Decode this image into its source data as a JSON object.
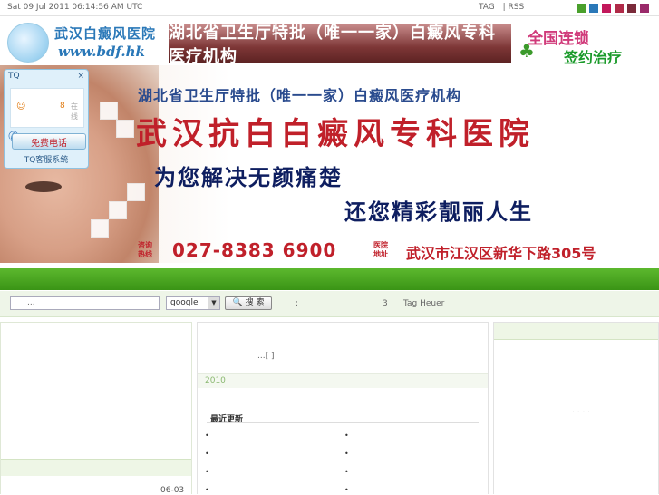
{
  "topbar": {
    "date": "Sat 09 Jul 2011 06:14:56 AM UTC",
    "links": [
      "TAG",
      "| RSS"
    ],
    "swatches": [
      "#4aa02c",
      "#2a78b8",
      "#c2185b",
      "#b02a48",
      "#7a2a3a",
      "#9a2a6a"
    ]
  },
  "header": {
    "logo_cn": "武汉白癜风医院",
    "logo_en": "www.bdf.hk",
    "banner_text": "湖北省卫生厅特批（唯一一家）白癜风专科医疗机构",
    "chain_line1": "全国连锁",
    "chain_line2": "签约治疗"
  },
  "hero": {
    "line1": "湖北省卫生厅特批（唯一一家）白癜风医疗机构",
    "hospital_name": "武汉抗白白癜风专科医院",
    "slogan1": "为您解决无颜痛楚",
    "slogan2": "还您精彩靓丽人生",
    "hotline_label1": "咨询",
    "hotline_label2": "热线",
    "phone": "027-8383 6900",
    "addr_label1": "医院",
    "addr_label2": "地址",
    "address": "武汉市江汉区新华下路305号"
  },
  "tq": {
    "title": "TQ",
    "close": "×",
    "number": "8",
    "status": "在线",
    "call_label": "免费电话",
    "footer": "TQ客服系统"
  },
  "search": {
    "placeholder": "...",
    "engine": "google",
    "button": "搜 索",
    "colon": ":",
    "count": "3",
    "tag": "Tag Heuer"
  },
  "left": {
    "date": "06-03"
  },
  "middle": {
    "more": "...[ ]",
    "year": "2010",
    "recent_title": "最近更新",
    "bullets": [
      "•",
      "•",
      "•",
      "•",
      "•",
      "•",
      "•",
      "•"
    ]
  },
  "right": {
    "dots": ". . . ."
  }
}
